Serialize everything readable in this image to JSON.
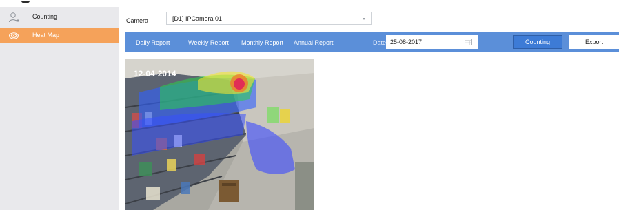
{
  "sidebar": {
    "items": [
      {
        "label": "Counting",
        "icon": "person-counting-icon",
        "active": false
      },
      {
        "label": "Heat Map",
        "icon": "heat-map-icon",
        "active": true
      }
    ],
    "active_color": "#f5a25a"
  },
  "camera": {
    "label": "Camera",
    "selected": "[D1] IPCamera 01"
  },
  "report_tabs": [
    "Daily Report",
    "Weekly Report",
    "Monthly Report",
    "Annual Report"
  ],
  "date": {
    "label": "Date",
    "value": "25-08-2017",
    "icon": "calendar-icon"
  },
  "buttons": {
    "counting": "Counting",
    "export": "Export"
  },
  "video": {
    "timestamp": "12-04-2014"
  },
  "colors": {
    "toolbar": "#5b8fd9",
    "primary_button": "#3d7bd6",
    "sidebar_bg": "#e9e9ec"
  }
}
